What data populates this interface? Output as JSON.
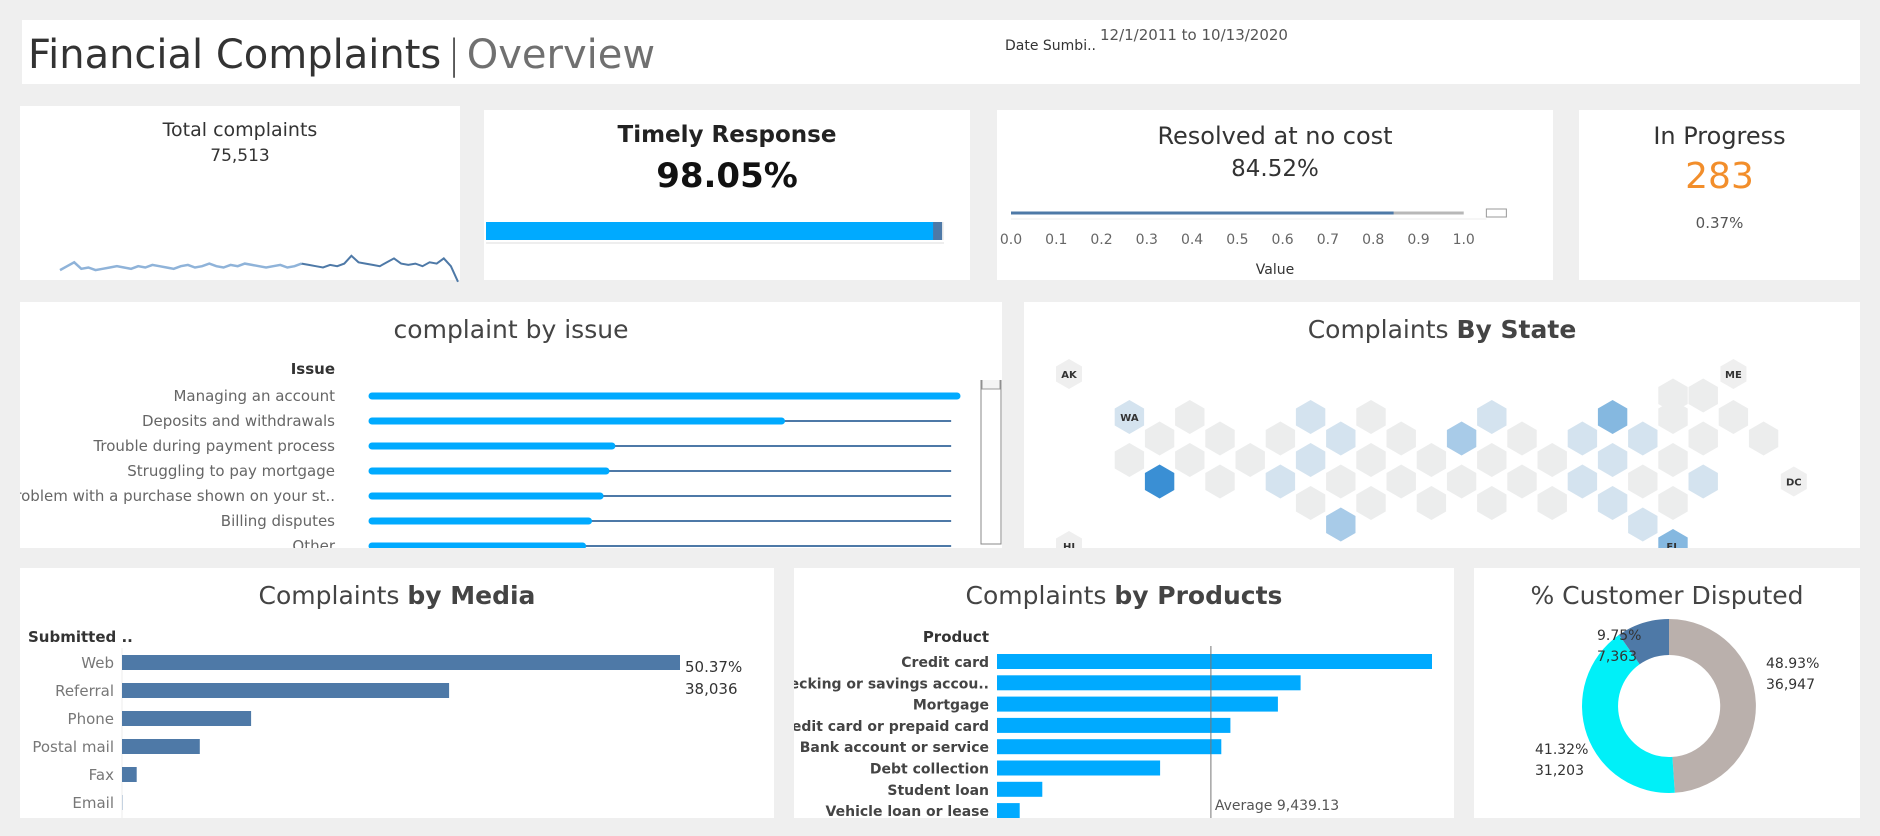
{
  "header": {
    "title_main": "Financial Complaints",
    "title_sep": "|",
    "title_sub": "Overview",
    "date_label": "Date Sumbi..",
    "date_value": "12/1/2011 to 10/13/2020"
  },
  "kpi_total": {
    "label": "Total complaints",
    "value": "75,513"
  },
  "kpi_timely": {
    "label": "Timely Response",
    "value": "98.05%",
    "fraction": 0.9805
  },
  "kpi_resolved": {
    "label": "Resolved at no cost",
    "value": "84.52%",
    "fraction": 0.8452,
    "axis_label": "Value"
  },
  "kpi_progress": {
    "label": "In Progress",
    "value": "283",
    "pct": "0.37%",
    "accent": "#f28e2b"
  },
  "issues": {
    "title": "complaint by issue",
    "header": "Issue"
  },
  "states": {
    "title_a": "Complaints ",
    "title_b": "By State"
  },
  "media": {
    "title_a": "Complaints ",
    "title_b": "by Media",
    "header": "Submitted .."
  },
  "products": {
    "title_a": "Complaints ",
    "title_b": "by Products",
    "header": "Product",
    "avg_label": "Average 9,439.13"
  },
  "disputed": {
    "title": "% Customer Disputed"
  },
  "colors": {
    "blue_bright": "#00aaff",
    "steel": "#4e79a7",
    "cyan": "#00f0f8",
    "taupe": "#bab0ac",
    "hex_base": "#eceded"
  },
  "chart_data": [
    {
      "id": "total-sparkline",
      "type": "line",
      "values": [
        3,
        6,
        9,
        4,
        5,
        3,
        4,
        5,
        6,
        5,
        4,
        6,
        5,
        7,
        6,
        5,
        4,
        6,
        7,
        5,
        6,
        8,
        6,
        5,
        7,
        6,
        8,
        7,
        6,
        5,
        6,
        7,
        5,
        6,
        8,
        7,
        6,
        5,
        7,
        6,
        8,
        14,
        9,
        8,
        7,
        6,
        9,
        12,
        8,
        7,
        8,
        6,
        9,
        8,
        12,
        6,
        -6
      ]
    },
    {
      "id": "timely-bullet",
      "type": "bar",
      "categories": [
        "Timely Response"
      ],
      "values": [
        0.9805
      ],
      "target": 0.9805
    },
    {
      "id": "resolved-bullet",
      "type": "bar",
      "categories": [
        "Resolved at no cost"
      ],
      "values": [
        0.8452
      ],
      "xlabel": "Value",
      "ticks": [
        "0.0",
        "0.1",
        "0.2",
        "0.3",
        "0.4",
        "0.5",
        "0.6",
        "0.7",
        "0.8",
        "0.9",
        "1.0"
      ],
      "xlim": [
        0,
        1.1
      ]
    },
    {
      "id": "issue-bars",
      "type": "bar",
      "title": "complaint by issue",
      "categories": [
        "Managing an account",
        "Deposits and withdrawals",
        "Trouble during payment process",
        "Struggling to pay mortgage",
        "Problem with a purchase shown on your st..",
        "Billing disputes",
        "Other"
      ],
      "values": [
        1.0,
        0.7,
        0.41,
        0.4,
        0.39,
        0.37,
        0.36
      ],
      "ref_value": 0.99
    },
    {
      "id": "state-hexmap",
      "type": "heatmap",
      "title": "Complaints By State",
      "labels": [
        "AK",
        "ME",
        "WA",
        "HI",
        "FL",
        "DC"
      ],
      "cells": [
        {
          "c": 0,
          "r": 0,
          "v": 0,
          "lab": "AK",
          "solo": true
        },
        {
          "c": 22,
          "r": 0,
          "v": 0,
          "lab": "ME",
          "solo": true
        },
        {
          "c": 20,
          "r": 1,
          "v": 0
        },
        {
          "c": 21,
          "r": 1,
          "v": 0
        },
        {
          "c": 2,
          "r": 2,
          "v": 0.25,
          "lab": "WA"
        },
        {
          "c": 4,
          "r": 2,
          "v": 0
        },
        {
          "c": 8,
          "r": 2,
          "v": 0.2
        },
        {
          "c": 10,
          "r": 2,
          "v": 0
        },
        {
          "c": 14,
          "r": 2,
          "v": 0.2
        },
        {
          "c": 18,
          "r": 2,
          "v": 0.6
        },
        {
          "c": 20,
          "r": 2,
          "v": 0
        },
        {
          "c": 22,
          "r": 2,
          "v": 0
        },
        {
          "c": 3,
          "r": 3,
          "v": 0
        },
        {
          "c": 5,
          "r": 3,
          "v": 0
        },
        {
          "c": 7,
          "r": 3,
          "v": 0
        },
        {
          "c": 9,
          "r": 3,
          "v": 0.2
        },
        {
          "c": 11,
          "r": 3,
          "v": 0
        },
        {
          "c": 13,
          "r": 3,
          "v": 0.4
        },
        {
          "c": 15,
          "r": 3,
          "v": 0
        },
        {
          "c": 17,
          "r": 3,
          "v": 0.2
        },
        {
          "c": 19,
          "r": 3,
          "v": 0.3
        },
        {
          "c": 21,
          "r": 3,
          "v": 0
        },
        {
          "c": 23,
          "r": 3,
          "v": 0
        },
        {
          "c": 2,
          "r": 4,
          "v": 0
        },
        {
          "c": 4,
          "r": 4,
          "v": 0
        },
        {
          "c": 6,
          "r": 4,
          "v": 0
        },
        {
          "c": 8,
          "r": 4,
          "v": 0.2
        },
        {
          "c": 10,
          "r": 4,
          "v": 0
        },
        {
          "c": 12,
          "r": 4,
          "v": 0
        },
        {
          "c": 14,
          "r": 4,
          "v": 0
        },
        {
          "c": 16,
          "r": 4,
          "v": 0
        },
        {
          "c": 18,
          "r": 4,
          "v": 0.2
        },
        {
          "c": 20,
          "r": 4,
          "v": 0
        },
        {
          "c": 3,
          "r": 5,
          "v": 1.0
        },
        {
          "c": 5,
          "r": 5,
          "v": 0
        },
        {
          "c": 7,
          "r": 5,
          "v": 0.2
        },
        {
          "c": 9,
          "r": 5,
          "v": 0
        },
        {
          "c": 11,
          "r": 5,
          "v": 0
        },
        {
          "c": 13,
          "r": 5,
          "v": 0
        },
        {
          "c": 15,
          "r": 5,
          "v": 0
        },
        {
          "c": 17,
          "r": 5,
          "v": 0.2
        },
        {
          "c": 19,
          "r": 5,
          "v": 0
        },
        {
          "c": 21,
          "r": 5,
          "v": 0.2
        },
        {
          "c": 24,
          "r": 5,
          "v": 0,
          "lab": "DC",
          "solo": true
        },
        {
          "c": 8,
          "r": 6,
          "v": 0
        },
        {
          "c": 10,
          "r": 6,
          "v": 0
        },
        {
          "c": 12,
          "r": 6,
          "v": 0
        },
        {
          "c": 14,
          "r": 6,
          "v": 0
        },
        {
          "c": 16,
          "r": 6,
          "v": 0
        },
        {
          "c": 18,
          "r": 6,
          "v": 0.2
        },
        {
          "c": 20,
          "r": 6,
          "v": 0
        },
        {
          "c": 9,
          "r": 7,
          "v": 0.45
        },
        {
          "c": 19,
          "r": 7,
          "v": 0.2
        },
        {
          "c": 0,
          "r": 8,
          "v": 0,
          "lab": "HI",
          "solo": true
        },
        {
          "c": 20,
          "r": 8,
          "v": 0.55,
          "lab": "FL"
        }
      ]
    },
    {
      "id": "media-bars",
      "type": "bar",
      "title": "Complaints by Media",
      "categories": [
        "Web",
        "Referral",
        "Phone",
        "Postal mail",
        "Fax",
        "Email"
      ],
      "values": [
        38036,
        22300,
        8800,
        5300,
        1000,
        20
      ],
      "labels": {
        "Web": [
          "50.37%",
          "38,036"
        ]
      }
    },
    {
      "id": "product-bars",
      "type": "bar",
      "title": "Complaints by Products",
      "categories": [
        "Credit card",
        "Checking or savings accou..",
        "Mortgage",
        "Credit card or prepaid card",
        "Bank account or service",
        "Debt collection",
        "Student loan",
        "Vehicle loan or lease"
      ],
      "values": [
        19200,
        13400,
        12400,
        10300,
        9900,
        7200,
        2000,
        1000
      ],
      "average": 9439.13
    },
    {
      "id": "disputed-donut",
      "type": "pie",
      "title": "% Customer Disputed",
      "slices": [
        {
          "name": "",
          "value": 48.93,
          "count": "36,947",
          "label": "48.93%",
          "color": "#bab0ac"
        },
        {
          "name": "",
          "value": 41.32,
          "count": "31,203",
          "label": "41.32%",
          "color": "#00f0f8"
        },
        {
          "name": "",
          "value": 9.75,
          "count": "7,363",
          "label": "9.75%",
          "color": "#4e79a7"
        }
      ]
    }
  ]
}
